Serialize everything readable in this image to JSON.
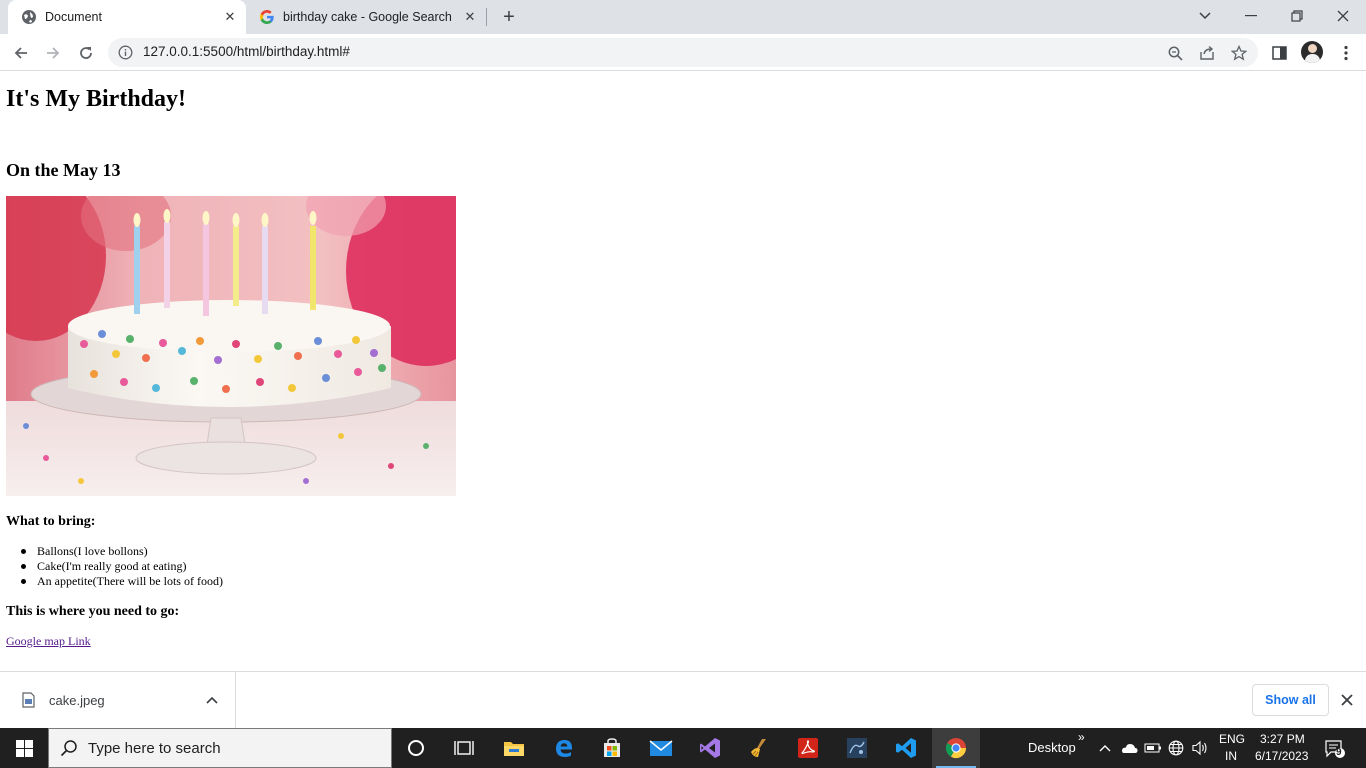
{
  "browser": {
    "tabs": [
      {
        "title": "Document",
        "icon": "globe-icon",
        "active": true
      },
      {
        "title": "birthday cake - Google Search",
        "icon": "google-g-icon",
        "active": false
      }
    ],
    "url": "127.0.0.1:5500/html/birthday.html#"
  },
  "page": {
    "title": "It's My Birthday!",
    "date_heading": "On the May 13",
    "image_alt": "birthday cake",
    "bring_heading": "What to bring:",
    "bring_items": [
      "Ballons(I love bollons)",
      "Cake(I'm really good at eating)",
      "An appetite(There will be lots of food)"
    ],
    "where_heading": "This is where you need to go:",
    "map_link": "Google map Link"
  },
  "downloads": {
    "file_name": "cake.jpeg",
    "show_all": "Show all"
  },
  "taskbar": {
    "search_placeholder": "Type here to search",
    "desktop_label": "Desktop",
    "language_line1": "ENG",
    "language_line2": "IN",
    "time": "3:27 PM",
    "date": "6/17/2023",
    "notification_count": "9"
  },
  "colors": {
    "tabstrip": "#dee1e6",
    "taskbar": "#202020",
    "link_visited": "#551a8b",
    "accent_blue": "#1a73e8"
  }
}
